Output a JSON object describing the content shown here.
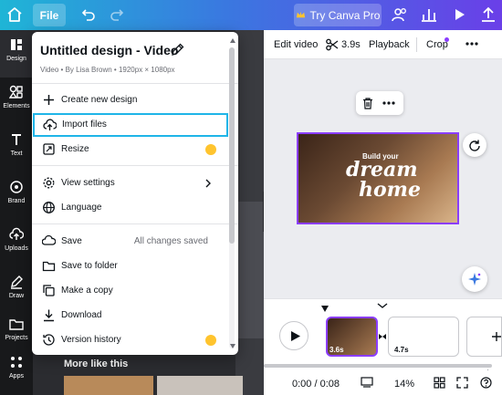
{
  "topbar": {
    "file_label": "File",
    "try_label": "Try Canva Pro",
    "accent": "#8b3dff"
  },
  "rail": {
    "items": [
      {
        "label": "Design",
        "icon": "design-icon"
      },
      {
        "label": "Elements",
        "icon": "elements-icon"
      },
      {
        "label": "Text",
        "icon": "text-icon"
      },
      {
        "label": "Brand",
        "icon": "brand-icon"
      },
      {
        "label": "Uploads",
        "icon": "upload-icon"
      },
      {
        "label": "Draw",
        "icon": "draw-icon"
      },
      {
        "label": "Projects",
        "icon": "folder-icon"
      },
      {
        "label": "Apps",
        "icon": "apps-icon"
      }
    ]
  },
  "panel": {
    "more_label": "More like this"
  },
  "edit_toolbar": {
    "edit_video": "Edit video",
    "duration": "3.9s",
    "playback": "Playback",
    "crop": "Crop"
  },
  "video": {
    "line1": "Build your",
    "line2": "dream",
    "line3": "home"
  },
  "timeline": {
    "clip1_duration": "3.6s",
    "clip2_duration": "4.7s",
    "time": "0:00 / 0:08",
    "zoom": "14%"
  },
  "menu": {
    "title": "Untitled design - Video",
    "subtitle": "Video • By Lisa Brown • 1920px × 1080px",
    "items": [
      {
        "label": "Create new design",
        "icon": "plus-icon"
      },
      {
        "label": "Import files",
        "icon": "cloud-upload-icon"
      },
      {
        "label": "Resize",
        "icon": "resize-icon"
      },
      {
        "label": "View settings",
        "icon": "gear-icon"
      },
      {
        "label": "Language",
        "icon": "globe-icon"
      },
      {
        "label": "Save",
        "icon": "save-icon",
        "right": "All changes saved"
      },
      {
        "label": "Save to folder",
        "icon": "folder-icon"
      },
      {
        "label": "Make a copy",
        "icon": "copy-icon"
      },
      {
        "label": "Download",
        "icon": "download-icon"
      },
      {
        "label": "Version history",
        "icon": "history-icon"
      }
    ]
  }
}
